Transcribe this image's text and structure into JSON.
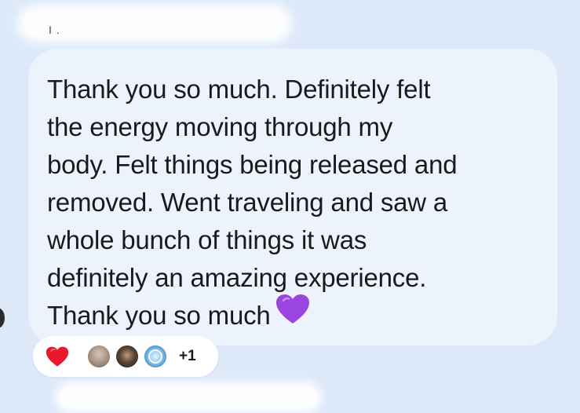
{
  "header": {
    "sender_name_fragment": "I ."
  },
  "message": {
    "lines": [
      "Thank you so much. Definitely felt",
      "the energy moving through my",
      "body. Felt things being released and",
      "removed. Went traveling and saw a",
      "whole bunch of things it was",
      "definitely an amazing experience.",
      "Thank you so much"
    ],
    "trailing_emoji": "purple-heart-icon"
  },
  "reactions": {
    "emoji": "red-heart-icon",
    "avatars": [
      "avatar-1",
      "avatar-2",
      "avatar-3"
    ],
    "extra_count": "+1"
  },
  "colors": {
    "background": "#dde9f9",
    "bubble": "#edf3fd",
    "text": "#1a1a1a",
    "purple_heart": "#9b45e0",
    "red_heart": "#e8192c"
  }
}
